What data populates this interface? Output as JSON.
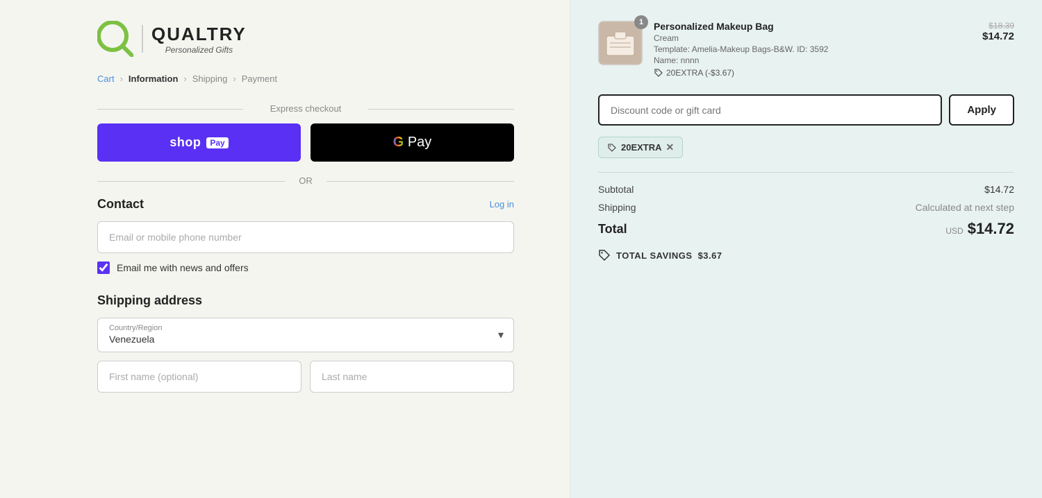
{
  "logo": {
    "q_letter": "Q",
    "brand": "QUALTRY",
    "tagline": "Personalized Gifts"
  },
  "breadcrumb": {
    "cart": "Cart",
    "information": "Information",
    "shipping": "Shipping",
    "payment": "Payment"
  },
  "express_checkout": {
    "label": "Express checkout"
  },
  "or_label": "OR",
  "contact": {
    "title": "Contact",
    "login_label": "Log in",
    "email_placeholder": "Email or mobile phone number",
    "newsletter_label": "Email me with news and offers"
  },
  "shipping": {
    "title": "Shipping address",
    "country_label": "Country/Region",
    "country_value": "Venezuela",
    "first_name_placeholder": "First name (optional)",
    "last_name_placeholder": "Last name"
  },
  "cart": {
    "product": {
      "name": "Personalized Makeup Bag",
      "variant": "Cream",
      "template": "Template: Amelia-Makeup Bags-B&W. ID: 3592",
      "person": "Name: nnnn",
      "discount_code": "20EXTRA (-$3.67)",
      "qty": "1",
      "price_original": "$18.39",
      "price_current": "$14.72"
    },
    "discount_input_placeholder": "Discount code or gift card",
    "apply_label": "Apply",
    "active_discount": "20EXTRA",
    "subtotal_label": "Subtotal",
    "subtotal_value": "$14.72",
    "shipping_label": "Shipping",
    "shipping_value": "Calculated at next step",
    "total_label": "Total",
    "currency": "USD",
    "total_value": "$14.72",
    "savings_label": "TOTAL SAVINGS",
    "savings_value": "$3.67"
  }
}
